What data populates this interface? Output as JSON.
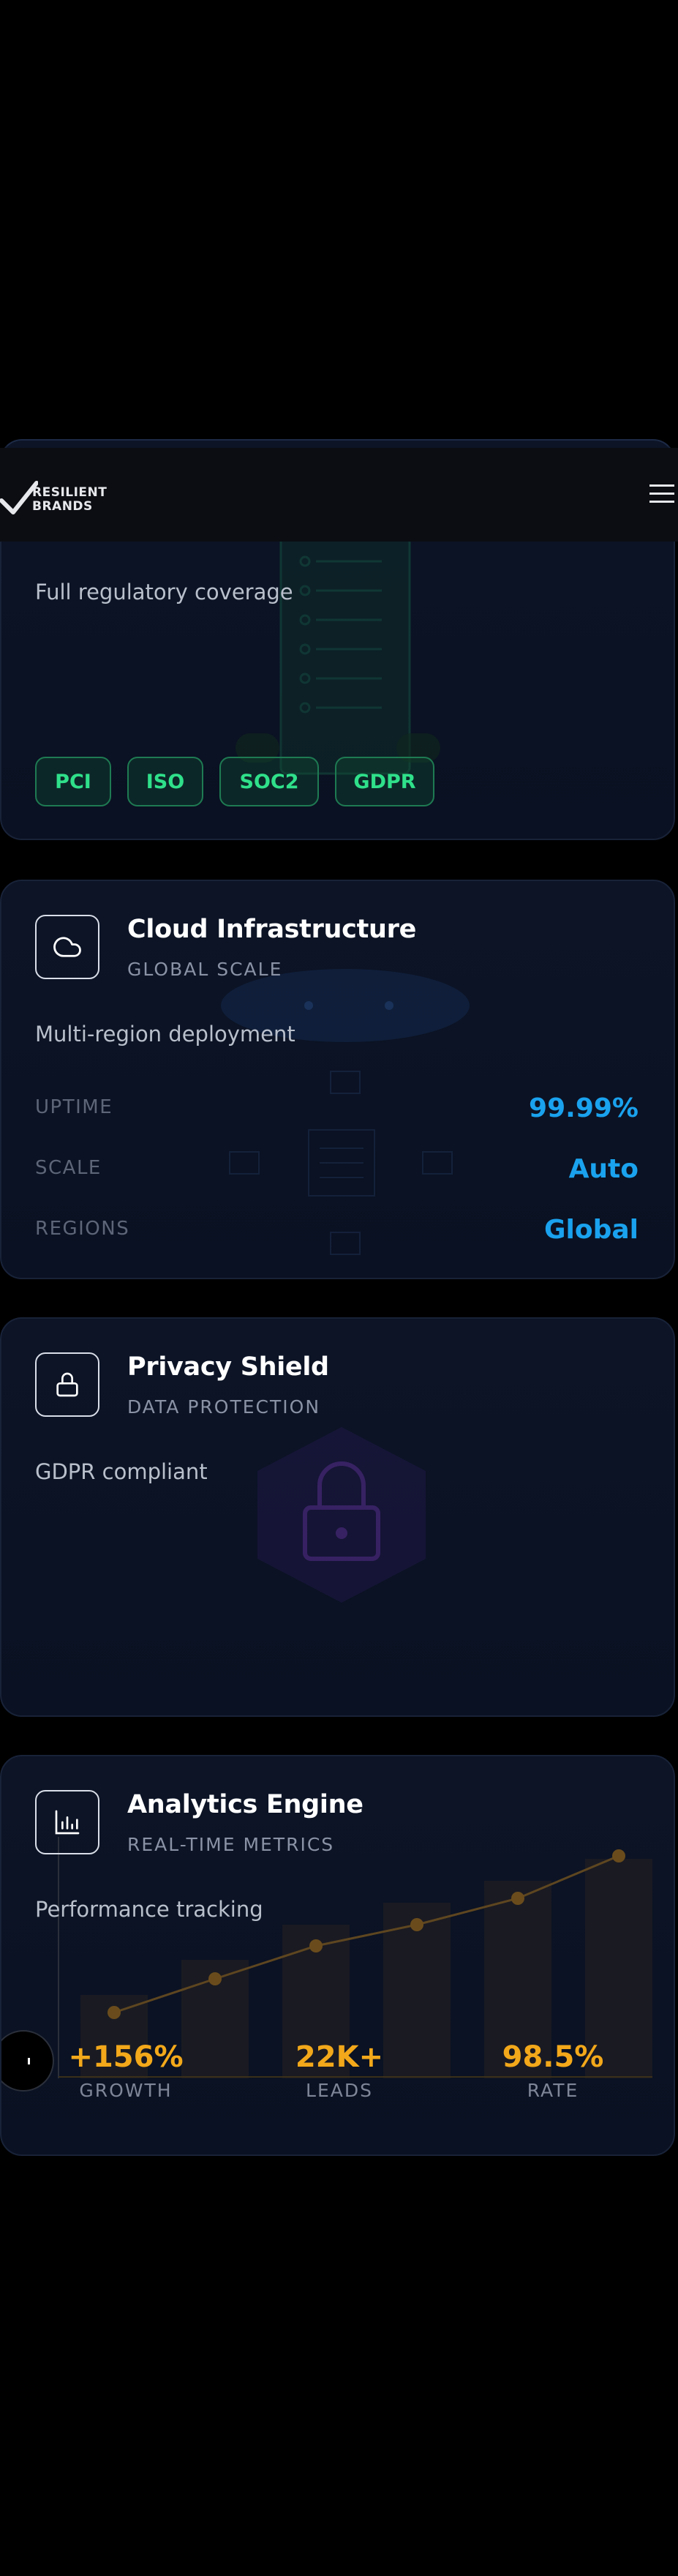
{
  "header": {
    "brand_line1": "RESILIENT",
    "brand_line2": "BRANDS",
    "menu_icon": "hamburger-menu-icon"
  },
  "cards": {
    "compliance": {
      "description": "Full regulatory coverage",
      "tags": [
        "PCI",
        "ISO",
        "SOC2",
        "GDPR"
      ]
    },
    "cloud": {
      "icon": "cloud-icon",
      "title": "Cloud Infrastructure",
      "subtitle": "GLOBAL SCALE",
      "description": "Multi-region deployment",
      "metrics": [
        {
          "label": "UPTIME",
          "value": "99.99%"
        },
        {
          "label": "SCALE",
          "value": "Auto"
        },
        {
          "label": "REGIONS",
          "value": "Global"
        }
      ]
    },
    "privacy": {
      "icon": "lock-icon",
      "title": "Privacy Shield",
      "subtitle": "DATA PROTECTION",
      "description": "GDPR compliant"
    },
    "analytics": {
      "icon": "bar-chart-icon",
      "title": "Analytics Engine",
      "subtitle": "REAL-TIME METRICS",
      "description": "Performance tracking",
      "stats": [
        {
          "value": "+156%",
          "label": "GROWTH"
        },
        {
          "value": "22K+",
          "label": "LEADS"
        },
        {
          "value": "98.5%",
          "label": "RATE"
        }
      ]
    }
  },
  "colors": {
    "background": "#000000",
    "card": "#0b1324",
    "tag_green": "#2fe08a",
    "metric_blue": "#1aa2ee",
    "stat_amber": "#f2a81a"
  }
}
